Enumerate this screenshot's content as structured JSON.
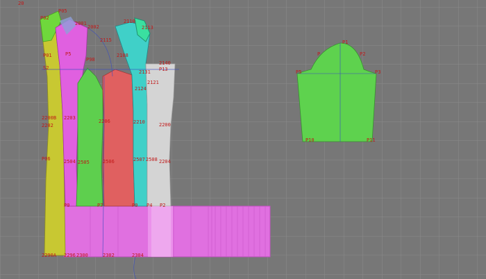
{
  "view": {
    "corner_label": "20",
    "background": "#777777",
    "grid_color": "#8a8a8a",
    "label_color": "#c01818"
  },
  "pieces": [
    {
      "name": "front-panel-yellow",
      "fill": "#c8c832"
    },
    {
      "name": "side-front-magenta",
      "fill": "#e060e0"
    },
    {
      "name": "panel-green",
      "fill": "#5ecf4e"
    },
    {
      "name": "panel-red",
      "fill": "#e06060"
    },
    {
      "name": "panel-cyan",
      "fill": "#40d0c8"
    },
    {
      "name": "panel-white",
      "fill": "#d0d0d0"
    },
    {
      "name": "sleeve-green",
      "fill": "#5ed24e"
    },
    {
      "name": "skirt-band-magenta",
      "fill": "#e070e0"
    }
  ],
  "labels": {
    "l1": "20",
    "l2": "P05",
    "l3": "P02",
    "l4": "2001",
    "l5": "2002",
    "l6": "P01",
    "l7": "S2",
    "l8": "2110",
    "l9": "2115",
    "l10": "2113",
    "l11": "2108",
    "l12": "2131",
    "l13": "2140",
    "l14": "P13",
    "l15": "2121",
    "l16": "2124",
    "l17": "P5",
    "l18": "P98",
    "l19": "2200B",
    "l20": "2202",
    "l21": "2203",
    "l22": "2206",
    "l23": "2210",
    "l24": "2200",
    "l25": "P06",
    "l26": "2504",
    "l27": "2505",
    "l28": "2506",
    "l29": "2507",
    "l30": "2508",
    "l31": "2204",
    "l32": "2290A",
    "l33": "2296",
    "l34": "2300",
    "l35": "2302",
    "l36": "2304",
    "l37": "P0",
    "l38": "P7",
    "l39": "P0",
    "l40": "P4",
    "l41": "P2",
    "l42": "P1",
    "l43": "P",
    "l44": "P2",
    "l45": "P5",
    "l46": "P3",
    "l47": "P10",
    "l48": "P11"
  }
}
